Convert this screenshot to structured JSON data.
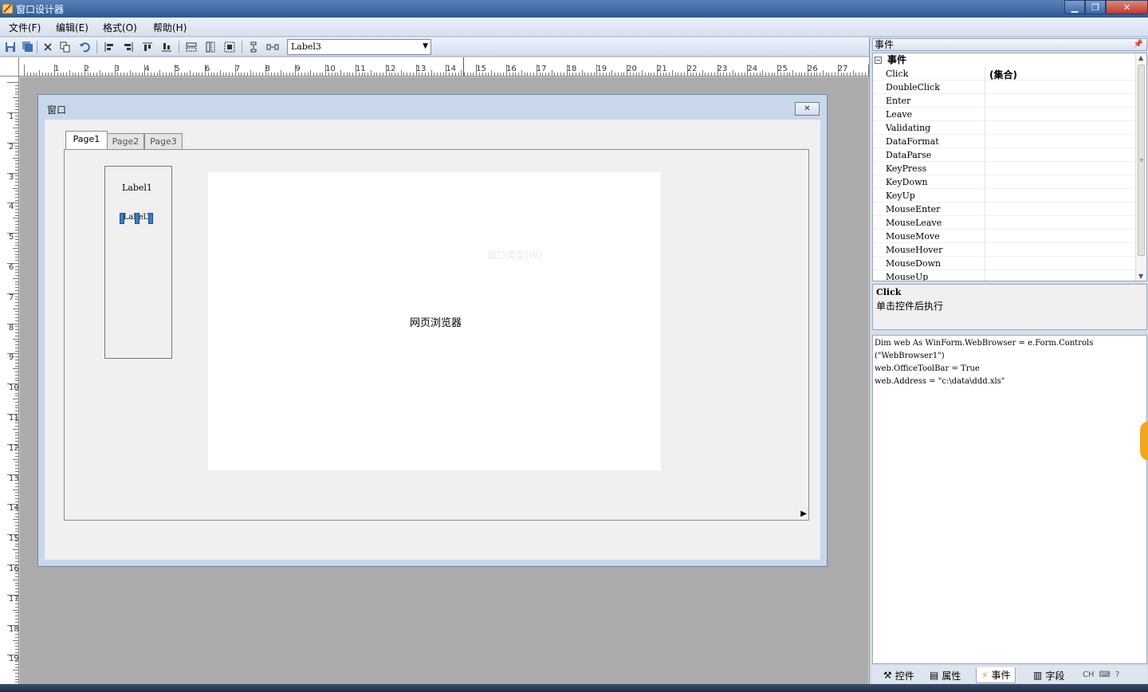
{
  "window": {
    "title": "窗口设计器"
  },
  "menu": [
    {
      "label": "文件(F)"
    },
    {
      "label": "编辑(E)"
    },
    {
      "label": "格式(O)"
    },
    {
      "label": "帮助(H)"
    }
  ],
  "toolbar": {
    "selected_control": "Label3"
  },
  "ruler": {
    "h": [
      "1",
      "2",
      "3",
      "4",
      "5",
      "6",
      "7",
      "8",
      "9",
      "10",
      "11",
      "12",
      "13",
      "14",
      "15",
      "16",
      "17",
      "18",
      "19",
      "20",
      "21",
      "22",
      "23",
      "24",
      "25",
      "26",
      "27"
    ],
    "v": [
      "1",
      "2",
      "3",
      "4",
      "5",
      "6",
      "7",
      "8",
      "9",
      "10",
      "11",
      "12",
      "13",
      "14",
      "15",
      "16",
      "17",
      "18",
      "19"
    ]
  },
  "designer": {
    "window_title": "窗口",
    "tabs": [
      "Page1",
      "Page2",
      "Page3"
    ],
    "label1": "Label1",
    "label3": "Label3",
    "browser_label": "网页浏览器",
    "browser_ghost": "窗口类型(W)"
  },
  "panel": {
    "header": "事件",
    "category": "事件",
    "events": [
      {
        "name": "Click",
        "value": "(集合)"
      },
      {
        "name": "DoubleClick",
        "value": ""
      },
      {
        "name": "Enter",
        "value": ""
      },
      {
        "name": "Leave",
        "value": ""
      },
      {
        "name": "Validating",
        "value": ""
      },
      {
        "name": "DataFormat",
        "value": ""
      },
      {
        "name": "DataParse",
        "value": ""
      },
      {
        "name": "KeyPress",
        "value": ""
      },
      {
        "name": "KeyDown",
        "value": ""
      },
      {
        "name": "KeyUp",
        "value": ""
      },
      {
        "name": "MouseEnter",
        "value": ""
      },
      {
        "name": "MouseLeave",
        "value": ""
      },
      {
        "name": "MouseMove",
        "value": ""
      },
      {
        "name": "MouseHover",
        "value": ""
      },
      {
        "name": "MouseDown",
        "value": ""
      },
      {
        "name": "MouseUp",
        "value": ""
      }
    ],
    "description_title": "Click",
    "description_text": "单击控件后执行",
    "code": "Dim web As WinForm.WebBrowser = e.Form.Controls\n(\"WebBrowser1\")\nweb.OfficeToolBar = True\nweb.Address = \"c:\\data\\ddd.xls\"",
    "tabs": [
      {
        "label": "控件",
        "icon": "wrench-icon"
      },
      {
        "label": "属性",
        "icon": "properties-icon"
      },
      {
        "label": "事件",
        "icon": "lightning-icon"
      },
      {
        "label": "字段",
        "icon": "fields-icon"
      }
    ]
  },
  "tray": {
    "lang": "CH"
  },
  "colors": {
    "selection_handle": "#2f7fd6",
    "ruler_marker": "#dd2222"
  }
}
